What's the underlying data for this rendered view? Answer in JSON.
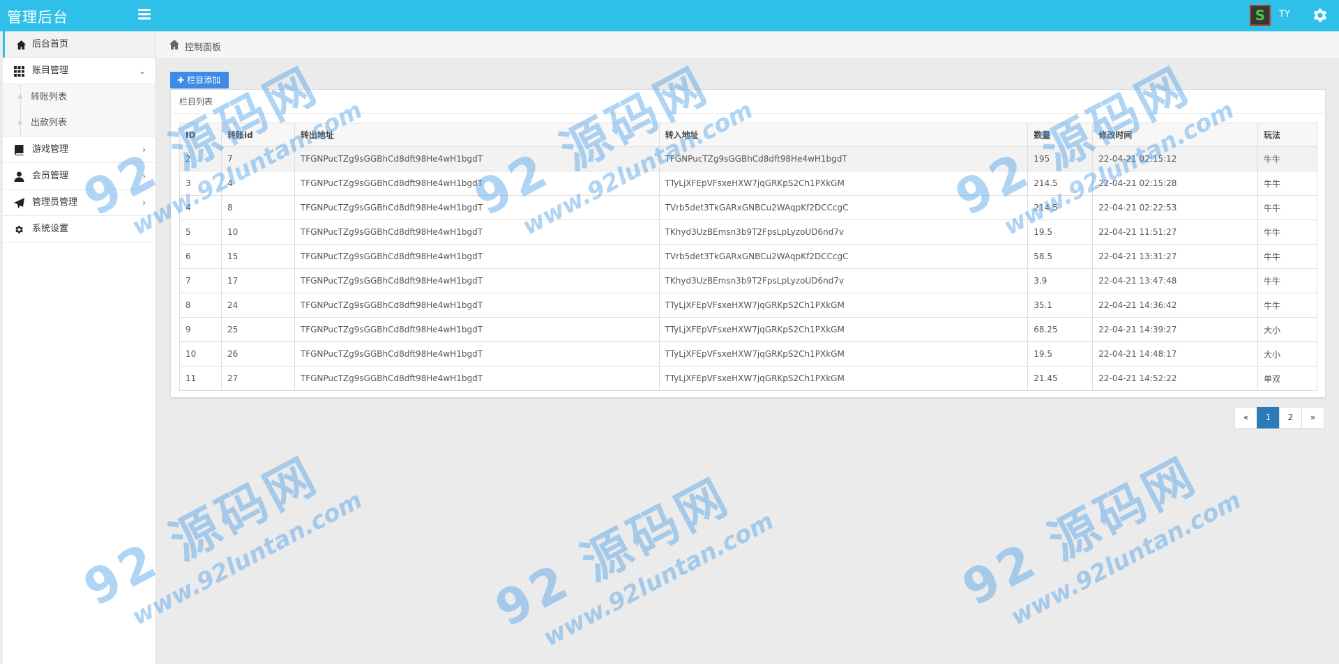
{
  "header": {
    "brand": "管理后台",
    "username": "TY",
    "avatar_letter": "S",
    "accent_color": "#2ec0e8"
  },
  "sidebar": {
    "items": [
      {
        "label": "后台首页",
        "icon": "home-icon"
      },
      {
        "label": "账目管理",
        "icon": "grid-icon",
        "chevron": "⌄"
      },
      {
        "label": "游戏管理",
        "icon": "book-icon",
        "chevron": "›"
      },
      {
        "label": "会员管理",
        "icon": "user-icon",
        "chevron": "›"
      },
      {
        "label": "管理员管理",
        "icon": "send-icon",
        "chevron": "›"
      },
      {
        "label": "系统设置",
        "icon": "cog-icon"
      }
    ],
    "sub_items": [
      "转账列表",
      "出款列表"
    ]
  },
  "breadcrumb": {
    "label": "控制面板"
  },
  "toolbar": {
    "add_label": "栏目添加"
  },
  "panel": {
    "title": "栏目列表"
  },
  "table": {
    "columns": [
      "ID",
      "转账id",
      "转出地址",
      "转入地址",
      "数量",
      "修改时间",
      "玩法"
    ],
    "rows": [
      [
        "2",
        "7",
        "TFGNPucTZg9sGGBhCd8dft98He4wH1bgdT",
        "TFGNPucTZg9sGGBhCd8dft98He4wH1bgdT",
        "195",
        "22-04-21 02:15:12",
        "牛牛"
      ],
      [
        "3",
        "4",
        "TFGNPucTZg9sGGBhCd8dft98He4wH1bgdT",
        "TTyLjXFEpVFsxeHXW7jqGRKpS2Ch1PXkGM",
        "214.5",
        "22-04-21 02:15:28",
        "牛牛"
      ],
      [
        "4",
        "8",
        "TFGNPucTZg9sGGBhCd8dft98He4wH1bgdT",
        "TVrb5det3TkGARxGNBCu2WAqpKf2DCCcgC",
        "214.5",
        "22-04-21 02:22:53",
        "牛牛"
      ],
      [
        "5",
        "10",
        "TFGNPucTZg9sGGBhCd8dft98He4wH1bgdT",
        "TKhyd3UzBEmsn3b9T2FpsLpLyzoUD6nd7v",
        "19.5",
        "22-04-21 11:51:27",
        "牛牛"
      ],
      [
        "6",
        "15",
        "TFGNPucTZg9sGGBhCd8dft98He4wH1bgdT",
        "TVrb5det3TkGARxGNBCu2WAqpKf2DCCcgC",
        "58.5",
        "22-04-21 13:31:27",
        "牛牛"
      ],
      [
        "7",
        "17",
        "TFGNPucTZg9sGGBhCd8dft98He4wH1bgdT",
        "TKhyd3UzBEmsn3b9T2FpsLpLyzoUD6nd7v",
        "3.9",
        "22-04-21 13:47:48",
        "牛牛"
      ],
      [
        "8",
        "24",
        "TFGNPucTZg9sGGBhCd8dft98He4wH1bgdT",
        "TTyLjXFEpVFsxeHXW7jqGRKpS2Ch1PXkGM",
        "35.1",
        "22-04-21 14:36:42",
        "牛牛"
      ],
      [
        "9",
        "25",
        "TFGNPucTZg9sGGBhCd8dft98He4wH1bgdT",
        "TTyLjXFEpVFsxeHXW7jqGRKpS2Ch1PXkGM",
        "68.25",
        "22-04-21 14:39:27",
        "大小"
      ],
      [
        "10",
        "26",
        "TFGNPucTZg9sGGBhCd8dft98He4wH1bgdT",
        "TTyLjXFEpVFsxeHXW7jqGRKpS2Ch1PXkGM",
        "19.5",
        "22-04-21 14:48:17",
        "大小"
      ],
      [
        "11",
        "27",
        "TFGNPucTZg9sGGBhCd8dft98He4wH1bgdT",
        "TTyLjXFEpVFsxeHXW7jqGRKpS2Ch1PXkGM",
        "21.45",
        "22-04-21 14:52:22",
        "单双"
      ]
    ]
  },
  "pagination": {
    "prev": "«",
    "pages": [
      "1",
      "2"
    ],
    "current": "1",
    "next": "»"
  },
  "watermark": {
    "brand": "92 源码网",
    "url": "www.92luntan.com"
  }
}
